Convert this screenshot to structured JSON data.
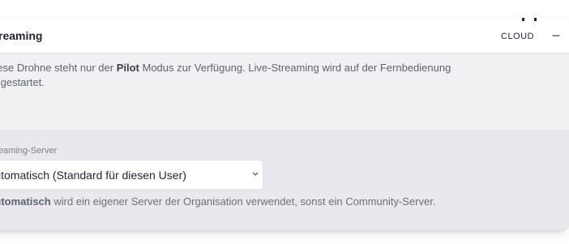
{
  "header": {
    "title": "Streaming",
    "logo_text": "CLOUD",
    "minus_label": "–"
  },
  "info": {
    "text_before": "Diese Drohne steht nur der ",
    "emphasis": "Pilot",
    "text_after": " Modus zur Verfügung. Live-Streaming wird auf der Fernbedienung",
    "line2": "ist gestartet."
  },
  "server": {
    "label": "Streaming-Server",
    "selected_value": "Automatisch (Standard für diesen User)",
    "hint_emphasis": "Automatisch",
    "hint_text": " wird ein eigener Server der Organisation verwendet, sonst ein Community-Server."
  }
}
